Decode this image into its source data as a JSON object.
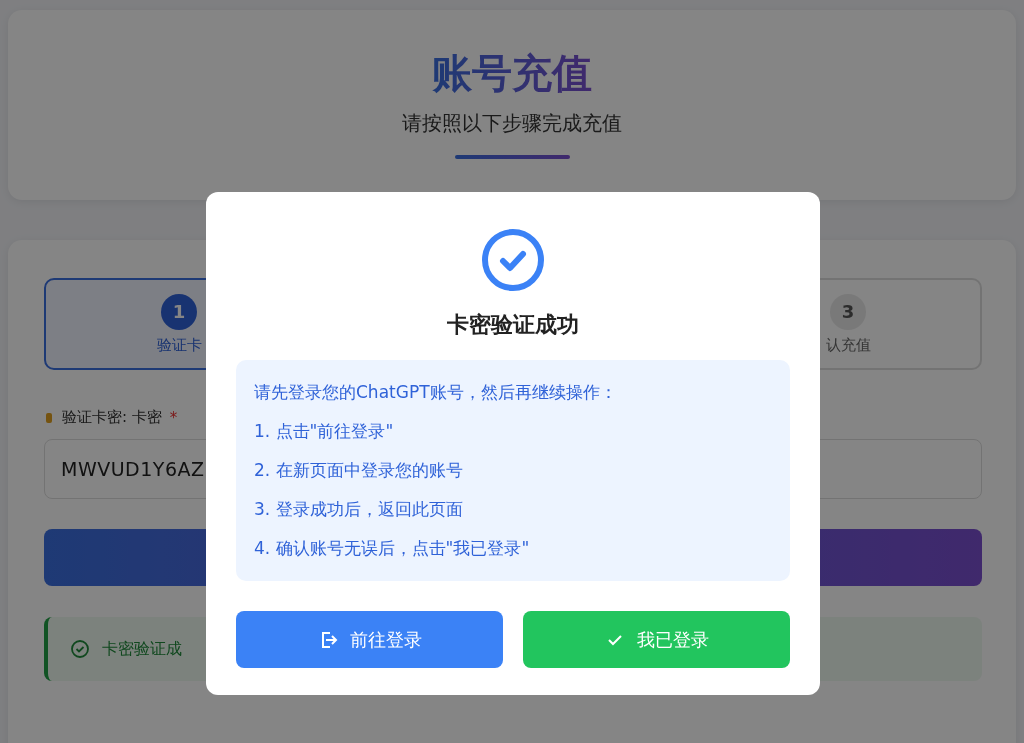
{
  "header": {
    "title": "账号充值",
    "subtitle": "请按照以下步骤完成充值"
  },
  "steps": [
    {
      "number": "1",
      "label": "验证卡",
      "active": true
    },
    {
      "number": "3",
      "label": "认充值",
      "active": false
    }
  ],
  "form": {
    "label": "验证卡密: 卡密",
    "required": "*",
    "value": "MWVUD1Y6AZ"
  },
  "alert": {
    "text": "卡密验证成"
  },
  "dialog": {
    "title": "卡密验证成功",
    "intro": "请先登录您的ChatGPT账号，然后再继续操作：",
    "instructions": [
      "1. 点击\"前往登录\"",
      "2. 在新页面中登录您的账号",
      "3. 登录成功后，返回此页面",
      "4. 确认账号无误后，点击\"我已登录\""
    ],
    "buttons": [
      {
        "kind": "login",
        "label": "前往登录"
      },
      {
        "kind": "confirm",
        "label": "我已登录"
      }
    ]
  }
}
